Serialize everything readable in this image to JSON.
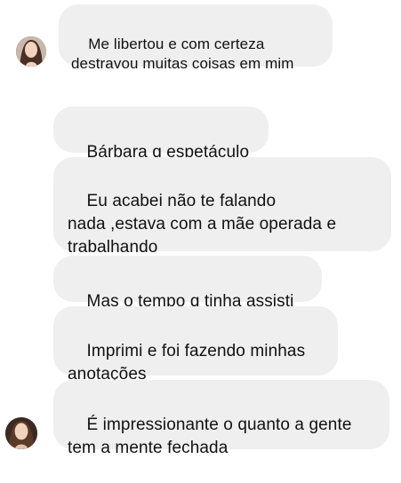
{
  "messages": [
    {
      "text": "Me libertou e com certeza\ndestravou muitas coisas em mim"
    },
    {
      "text": "Bárbara q espetáculo"
    },
    {
      "text": "Eu acabei não te falando\nnada ,estava com a mãe operada e\ntrabalhando"
    },
    {
      "text": "Mas o tempo q tinha assisti"
    },
    {
      "text": "Imprimi e foi fazendo minhas\nanotações"
    },
    {
      "text": "É impressionante o quanto a gente\ntem a mente fechada"
    }
  ],
  "icons": {
    "avatar_top": "profile-photo-avatar",
    "avatar_bottom": "profile-photo-avatar"
  }
}
